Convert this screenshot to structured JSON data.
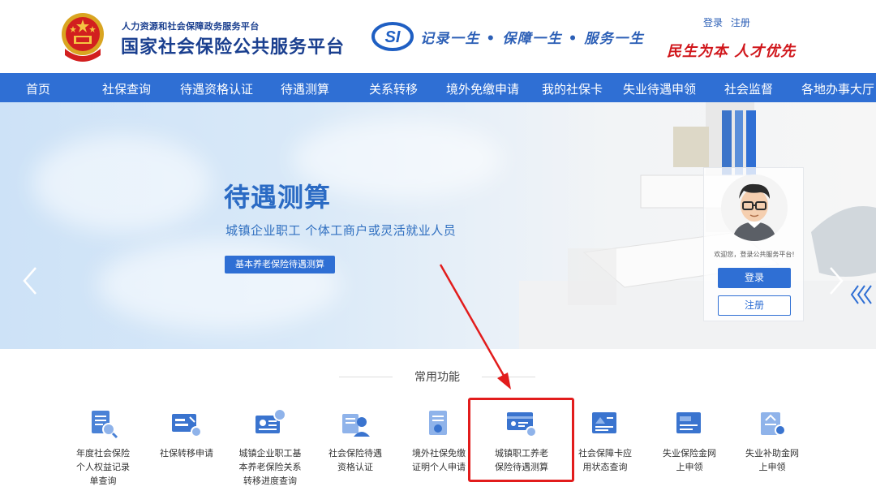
{
  "header": {
    "site_subtitle": "人力资源和社会保障政务服务平台",
    "site_title": "国家社会保险公共服务平台",
    "slogan": "记录一生 • 保障一生 • 服务一生",
    "login_link": "登录",
    "register_link": "注册",
    "motto": "民生为本 人才优先"
  },
  "nav": {
    "items": [
      {
        "label": "首页"
      },
      {
        "label": "社保查询"
      },
      {
        "label": "待遇资格认证"
      },
      {
        "label": "待遇测算"
      },
      {
        "label": "关系转移"
      },
      {
        "label": "境外免缴申请"
      },
      {
        "label": "我的社保卡"
      },
      {
        "label": "失业待遇申领"
      },
      {
        "label": "社会监督"
      },
      {
        "label": "各地办事大厅"
      }
    ]
  },
  "banner": {
    "title": "待遇测算",
    "subtitle": "城镇企业职工  个体工商户或灵活就业人员",
    "button_label": "基本养老保险待遇测算"
  },
  "login_card": {
    "welcome": "欢迎您，登录公共服务平台!",
    "login_label": "登录",
    "register_label": "注册"
  },
  "functions": {
    "section_title": "常用功能",
    "items": [
      {
        "label": "年度社会保险\n个人权益记录\n单查询",
        "icon": "record-doc-icon"
      },
      {
        "label": "社保转移申请",
        "icon": "transfer-card-icon"
      },
      {
        "label": "城镇企业职工基\n本养老保险关系\n转移进度查询",
        "icon": "pension-transfer-icon"
      },
      {
        "label": "社会保险待遇\n资格认证",
        "icon": "certification-icon"
      },
      {
        "label": "境外社保免缴\n证明个人申请",
        "icon": "overseas-exemption-icon"
      },
      {
        "label": "城镇职工养老\n保险待遇测算",
        "icon": "pension-calc-icon"
      },
      {
        "label": "社会保障卡应\n用状态查询",
        "icon": "card-status-icon"
      },
      {
        "label": "失业保险金网\n上申领",
        "icon": "unemployment-insurance-icon"
      },
      {
        "label": "失业补助金网\n上申领",
        "icon": "unemployment-subsidy-icon"
      }
    ]
  },
  "colors": {
    "primary": "#2f6fd4",
    "title_blue": "#1a3f8f",
    "motto_red": "#d0161b",
    "highlight_red": "#e21c1c"
  }
}
